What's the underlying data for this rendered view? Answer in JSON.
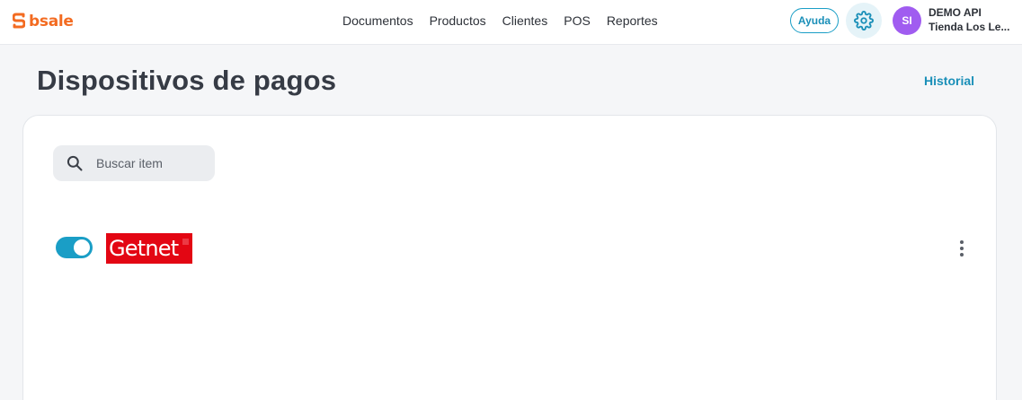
{
  "brand": {
    "name": "bsale",
    "color": "#f36b21"
  },
  "nav": {
    "items": [
      "Documentos",
      "Productos",
      "Clientes",
      "POS",
      "Reportes"
    ]
  },
  "header": {
    "help_label": "Ayuda",
    "settings_icon": "gear-icon",
    "user": {
      "initials": "SI",
      "name": "DEMO API",
      "store": "Tienda Los Le...",
      "avatar_color": "#a05cf0"
    }
  },
  "page": {
    "title": "Dispositivos de pagos",
    "history_label": "Historial"
  },
  "search": {
    "placeholder": "Buscar item",
    "value": ""
  },
  "devices": [
    {
      "name": "Getnet",
      "enabled": true,
      "logo_color": "#e30613",
      "menu_icon": "more-vertical-icon"
    }
  ],
  "colors": {
    "accent": "#1a9ec6",
    "background": "#f5f6f8"
  }
}
